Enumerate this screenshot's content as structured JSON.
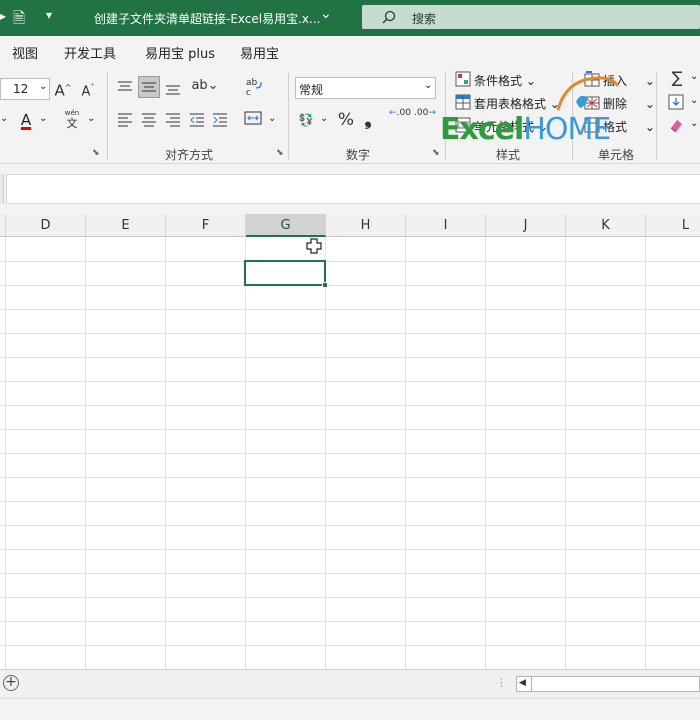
{
  "titlebar": {
    "filename": "创建子文件夹清单超链接-Excel易用宝.x...",
    "qat_dropdown": "▾",
    "title_chevron": "⌄",
    "search_placeholder": "搜索",
    "bg_color": "#217346"
  },
  "menu": {
    "items": [
      "视图",
      "开发工具",
      "易用宝 plus",
      "易用宝"
    ]
  },
  "ribbon": {
    "font": {
      "size_value": "12",
      "grow_font": "A",
      "shrink_font": "A",
      "font_color": "A",
      "phonetic": "文"
    },
    "alignment": {
      "group_label": "对齐方式"
    },
    "number": {
      "format_value": "常规",
      "percent": "%",
      "comma": "❟",
      "increase_decimal": ".00",
      "decrease_decimal": ".00",
      "group_label": "数字"
    },
    "styles": {
      "conditional_format": "条件格式",
      "table_format": "套用表格格式",
      "cell_styles": "单元格样式",
      "group_label": "样式"
    },
    "cells": {
      "insert": "插入",
      "delete": "删除",
      "format": "格式",
      "group_label": "单元格"
    },
    "editing": {
      "sum": "∑"
    }
  },
  "watermark": {
    "text_excel": "Excel",
    "text_home": "HOME"
  },
  "grid": {
    "columns": [
      "D",
      "E",
      "F",
      "G",
      "H",
      "I",
      "J",
      "K",
      "L"
    ],
    "selected_column": "G",
    "selected_cell": "G2"
  },
  "bottom": {
    "add_sheet": "+"
  },
  "colors": {
    "accent": "#217346",
    "logo_green": "#2e9b3e",
    "logo_blue": "#3a9ad9"
  }
}
